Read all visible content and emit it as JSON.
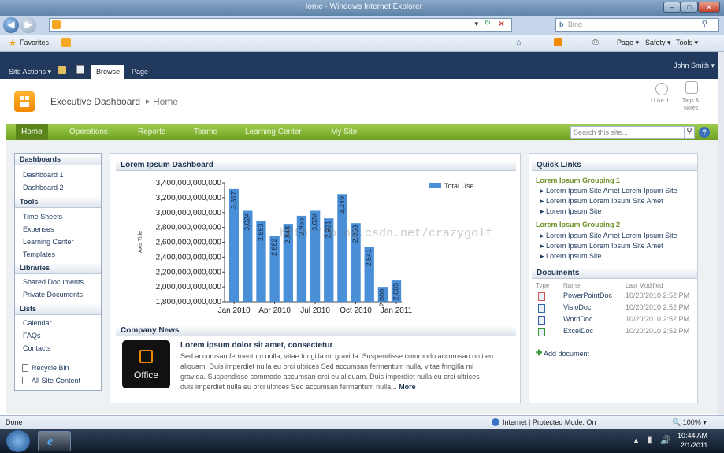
{
  "browser": {
    "title": "Home - Windows Internet Explorer",
    "search_placeholder": "Bing",
    "favorites_label": "Favorites",
    "tools": {
      "page": "Page ▾",
      "safety": "Safety ▾",
      "tools": "Tools ▾"
    },
    "status_left": "Done",
    "status_zone": "Internet | Protected Mode: On",
    "zoom": "100%"
  },
  "ribbon": {
    "site_actions": "Site Actions ▾",
    "tabs": [
      "Browse",
      "Page"
    ],
    "user": "John Smith ▾"
  },
  "site": {
    "title": "Executive Dashboard",
    "breadcrumb_sep": "▸",
    "page": "Home",
    "ilike": "I Like It",
    "tags": "Tags &",
    "notes": "Notes"
  },
  "topnav": {
    "items": [
      "Home",
      "Operations",
      "Reports",
      "Teams",
      "Learning Center",
      "My Site"
    ],
    "search_placeholder": "Search this site..."
  },
  "leftnav": {
    "sections": [
      {
        "title": "Dashboards",
        "items": [
          "Dashboard 1",
          "Dashboard 2"
        ]
      },
      {
        "title": "Tools",
        "items": [
          "Time Sheets",
          "Expenses",
          "Learning Center",
          "Templates"
        ]
      },
      {
        "title": "Libraries",
        "items": [
          "Shared Documents",
          "Private Documents"
        ]
      },
      {
        "title": "Lists",
        "items": [
          "Calendar",
          "FAQs",
          "Contacts"
        ]
      }
    ],
    "footer": [
      "Recycle Bin",
      "All Site Content"
    ]
  },
  "dashboard": {
    "title": "Lorem Ipsum Dashboard"
  },
  "chart_data": {
    "type": "bar",
    "ylabel": "Axis Title",
    "legend": "Total Use",
    "legend_position": "top-right",
    "ylim": [
      1800000000000,
      3400000000000
    ],
    "y_ticks": [
      "3,400,000,000,000",
      "3,200,000,000,000",
      "3,000,000,000,000",
      "2,800,000,000,000",
      "2,600,000,000,000",
      "2,400,000,000,000",
      "2,200,000,000,000",
      "2,000,000,000,000",
      "1,800,000,000,000"
    ],
    "x_ticks": [
      "Jan 2010",
      "Apr 2010",
      "Jul 2010",
      "Oct 2010",
      "Jan 2011"
    ],
    "series": [
      {
        "name": "Total Use",
        "values": [
          3317,
          3024,
          2883,
          2682,
          2848,
          2956,
          3024,
          2921,
          3249,
          2858,
          2541,
          2000,
          2085
        ]
      }
    ],
    "value_labels": [
      "3,317",
      "3,024",
      "2,883",
      "2,682",
      "2,848",
      "2,956",
      "3,024",
      "2,921",
      "3,249",
      "2,858",
      "2,541",
      "2,000",
      "2,085"
    ],
    "bar_color": "#4a90d9"
  },
  "news": {
    "title": "Company News",
    "logo_text": "Office",
    "headline": "Lorem ipsum dolor sit amet, consectetur",
    "lines": [
      "Sed accumsan fermentum nulla, vitae fringilla mi gravida. Suspendisse commodo accumsan orci eu",
      "aliquam. Duis imperdiet nulla eu orci ultrices Sed accumsan fermentum nulla, vitae fringilla mi",
      "gravida. Suspendisse commodo accumsan orci eu aliquam. Duis imperdiet nulla eu orci ultrices",
      "duis imperdiet nulla eu orci ultrices Sed accumsan fermentum nulla..."
    ],
    "more": "More"
  },
  "quicklinks": {
    "title": "Quick Links",
    "groups": [
      {
        "name": "Lorem Ipsum Grouping 1",
        "items": [
          "Lorem Ipsum Site Amet Lorem Ipsum Site",
          "Lorem Ipsum Lorem Ipsum Site Amet",
          "Lorem Ipsum Site"
        ]
      },
      {
        "name": "Lorem Ipsum Grouping 2",
        "items": [
          "Lorem Ipsum Site Amet Lorem Ipsum Site",
          "Lorem Ipsum Lorem Ipsum Site Amet",
          "Lorem Ipsum Site"
        ]
      }
    ]
  },
  "documents": {
    "title": "Documents",
    "headers": [
      "Type",
      "Name",
      "Last Modified"
    ],
    "rows": [
      {
        "name": "PowerPointDoc",
        "modified": "10/20/2010 2:52 PM"
      },
      {
        "name": "VisioDoc",
        "modified": "10/20/2010 2:52 PM"
      },
      {
        "name": "WordDoc",
        "modified": "10/20/2010 2:52 PM"
      },
      {
        "name": "ExcelDoc",
        "modified": "10/20/2010 2:52 PM"
      }
    ],
    "add": "Add document"
  },
  "taskbar": {
    "time": "10:44 AM",
    "date": "2/1/2011"
  },
  "watermark": "http://blog.csdn.net/crazygolf"
}
